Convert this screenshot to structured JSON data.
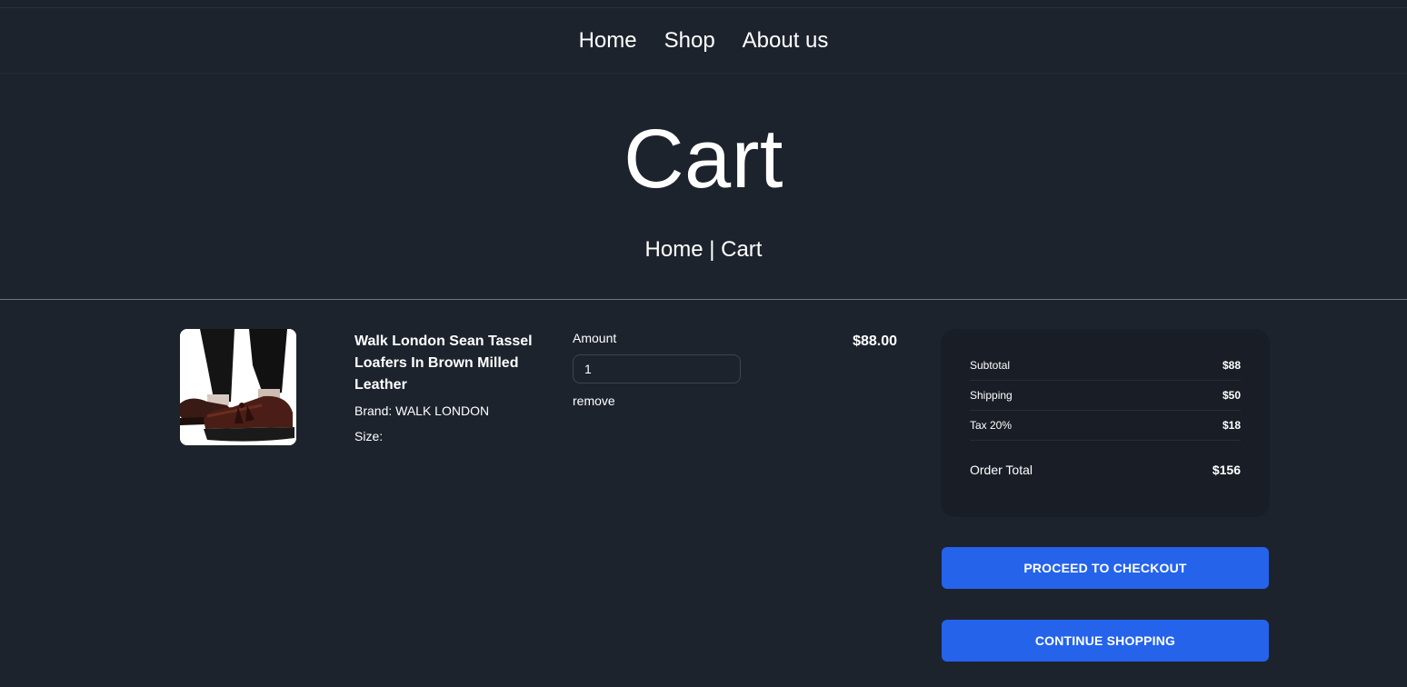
{
  "nav": {
    "items": [
      "Home",
      "Shop",
      "About us"
    ]
  },
  "hero": {
    "title": "Cart"
  },
  "breadcrumb": {
    "home": "Home",
    "separator": " | ",
    "current": "Cart"
  },
  "item": {
    "name": "Walk London Sean Tassel Loafers In Brown Milled Leather",
    "brand": "Brand: WALK LONDON",
    "size": "Size:",
    "amount_label": "Amount",
    "amount_value": "1",
    "remove_label": "remove",
    "price": "$88.00"
  },
  "summary": {
    "subtotal_label": "Subtotal",
    "subtotal_value": "$88",
    "shipping_label": "Shipping",
    "shipping_value": "$50",
    "tax_label": "Tax 20%",
    "tax_value": "$18",
    "total_label": "Order Total",
    "total_value": "$156"
  },
  "buttons": {
    "checkout": "PROCEED TO CHECKOUT",
    "continue": "CONTINUE SHOPPING"
  },
  "colors": {
    "background": "#1d232d",
    "card": "#191e26",
    "accent": "#2563eb",
    "divider": "#6b7280"
  }
}
